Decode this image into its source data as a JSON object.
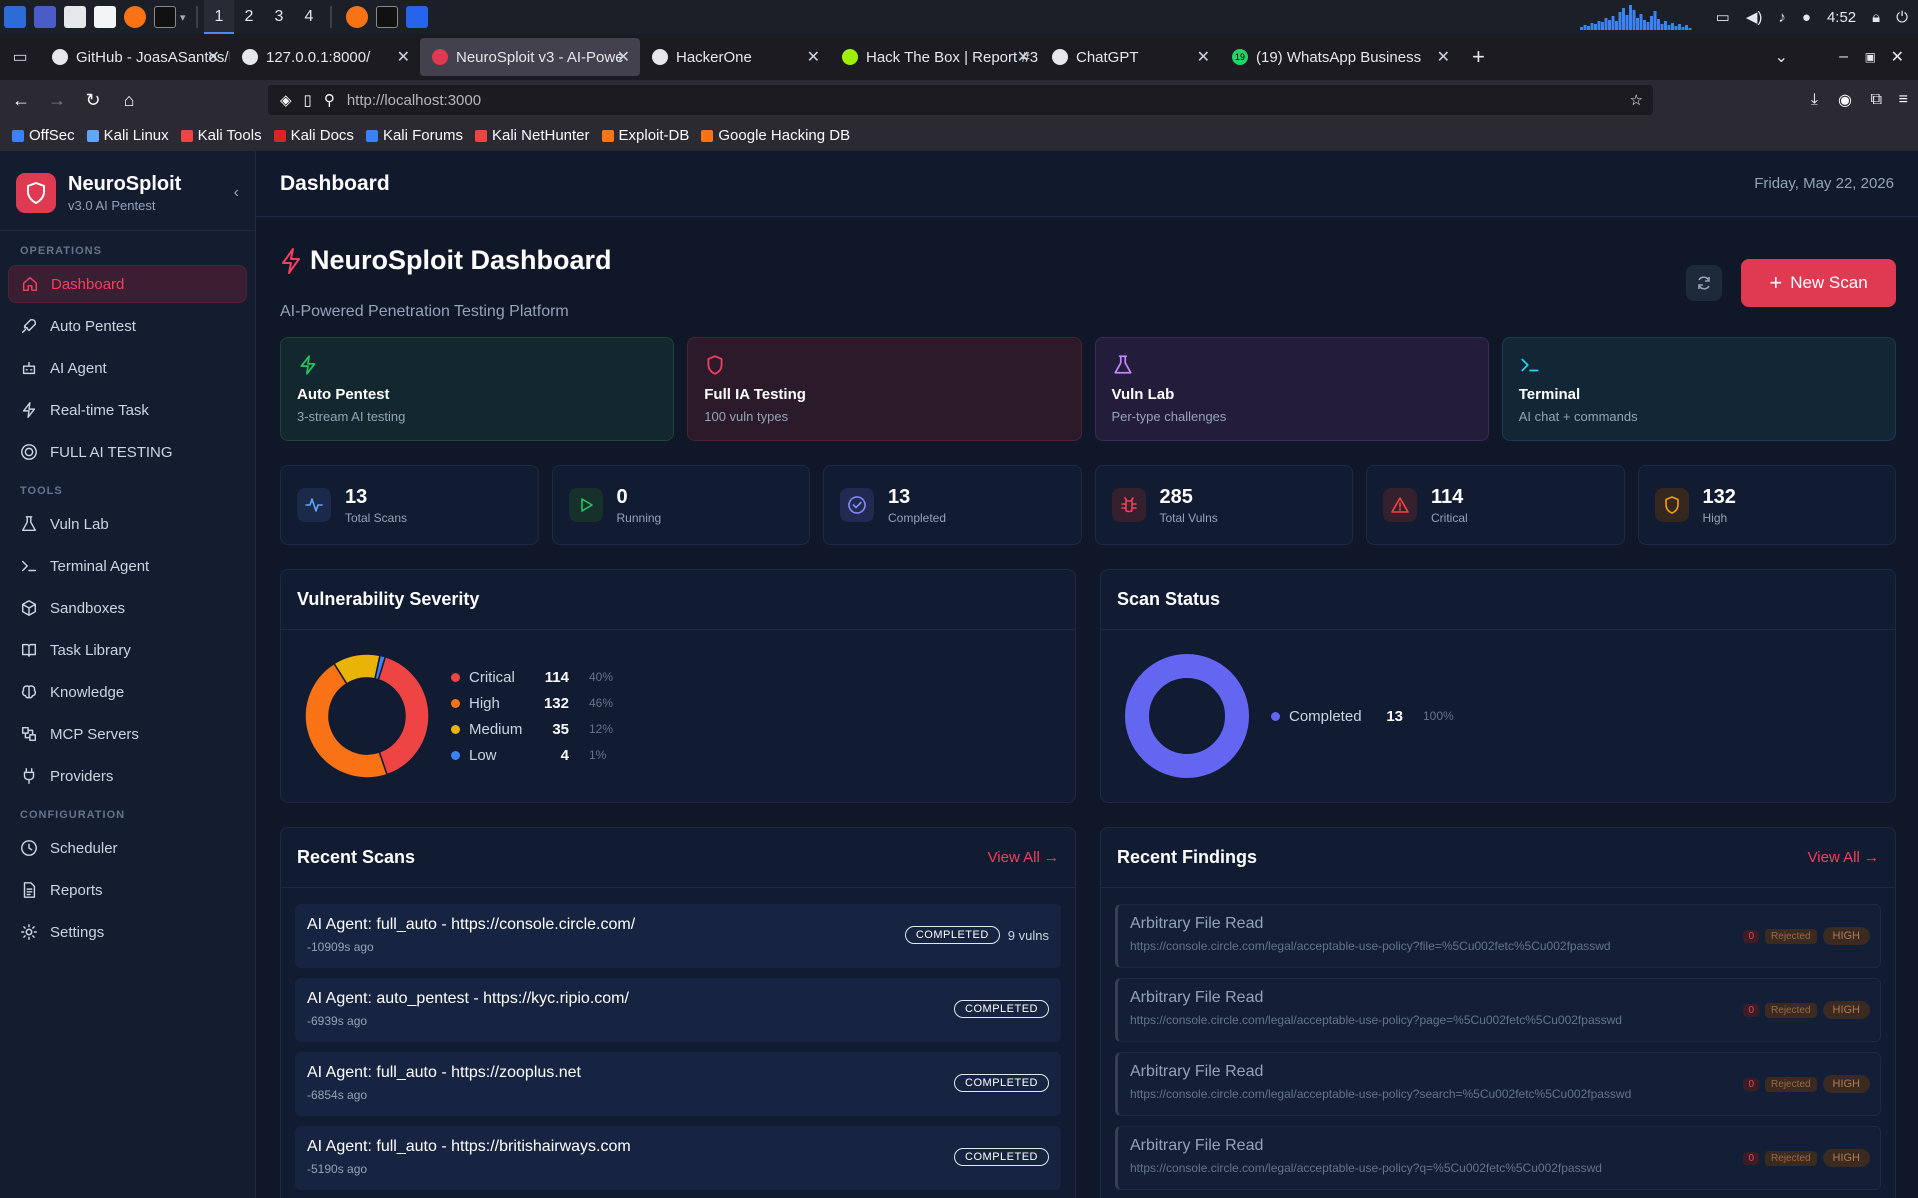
{
  "taskbar": {
    "workspaces": [
      "1",
      "2",
      "3",
      "4"
    ],
    "clock": "4:52"
  },
  "tabs": [
    {
      "label": "GitHub - JoasASantos/Ne",
      "color": "#e5e7eb"
    },
    {
      "label": "127.0.0.1:8000/",
      "color": "#e5e7eb"
    },
    {
      "label": "NeuroSploit v3 - AI-Powe",
      "color": "#e03a52"
    },
    {
      "label": "HackerOne",
      "color": "#e5e7eb"
    },
    {
      "label": "Hack The Box | Report #3",
      "color": "#9fef00"
    },
    {
      "label": "ChatGPT",
      "color": "#e5e7eb"
    },
    {
      "label": "(19) WhatsApp Business",
      "color": "#25d366"
    }
  ],
  "whatsapp_badge": "19",
  "url": "http://localhost:3000",
  "bookmarks": [
    {
      "label": "OffSec",
      "color": "#3b82f6"
    },
    {
      "label": "Kali Linux",
      "color": "#60a5fa"
    },
    {
      "label": "Kali Tools",
      "color": "#ef4444"
    },
    {
      "label": "Kali Docs",
      "color": "#dc2626"
    },
    {
      "label": "Kali Forums",
      "color": "#3b82f6"
    },
    {
      "label": "Kali NetHunter",
      "color": "#ef4444"
    },
    {
      "label": "Exploit-DB",
      "color": "#f97316"
    },
    {
      "label": "Google Hacking DB",
      "color": "#f97316"
    }
  ],
  "sidebar": {
    "brand": "NeuroSploit",
    "version": "v3.0 AI Pentest",
    "sections": [
      {
        "title": "OPERATIONS",
        "items": [
          {
            "label": "Dashboard",
            "icon": "home-icon",
            "active": true
          },
          {
            "label": "Auto Pentest",
            "icon": "rocket-icon"
          },
          {
            "label": "AI Agent",
            "icon": "bot-icon"
          },
          {
            "label": "Real-time Task",
            "icon": "bolt-icon"
          },
          {
            "label": "FULL AI TESTING",
            "icon": "target-icon"
          }
        ]
      },
      {
        "title": "TOOLS",
        "items": [
          {
            "label": "Vuln Lab",
            "icon": "flask-icon"
          },
          {
            "label": "Terminal Agent",
            "icon": "terminal-icon"
          },
          {
            "label": "Sandboxes",
            "icon": "box-icon"
          },
          {
            "label": "Task Library",
            "icon": "book-icon"
          },
          {
            "label": "Knowledge",
            "icon": "brain-icon"
          },
          {
            "label": "MCP Servers",
            "icon": "server-icon"
          },
          {
            "label": "Providers",
            "icon": "plug-icon"
          }
        ]
      },
      {
        "title": "CONFIGURATION",
        "items": [
          {
            "label": "Scheduler",
            "icon": "clock-icon"
          },
          {
            "label": "Reports",
            "icon": "file-icon"
          },
          {
            "label": "Settings",
            "icon": "gear-icon"
          }
        ]
      }
    ]
  },
  "header": {
    "title": "Dashboard",
    "date": "Friday, May 22, 2026"
  },
  "hero": {
    "title": "NeuroSploit Dashboard",
    "subtitle": "AI-Powered Penetration Testing Platform",
    "new_scan": "New Scan"
  },
  "quick_cards": [
    {
      "title": "Auto Pentest",
      "sub": "3-stream AI testing",
      "icon": "bolt-icon",
      "accent": "#22c55e",
      "bg": "#13272e",
      "border": "#1f4438"
    },
    {
      "title": "Full IA Testing",
      "sub": "100 vuln types",
      "icon": "shield-icon",
      "accent": "#f43f5e",
      "bg": "#2a1a2a",
      "border": "#4a2434"
    },
    {
      "title": "Vuln Lab",
      "sub": "Per-type challenges",
      "icon": "flask-icon",
      "accent": "#c084fc",
      "bg": "#231c3b",
      "border": "#3b2c5a"
    },
    {
      "title": "Terminal",
      "sub": "AI chat + commands",
      "icon": "terminal-icon",
      "accent": "#22d3ee",
      "bg": "#122636",
      "border": "#1d3c50"
    }
  ],
  "stats": [
    {
      "value": "13",
      "label": "Total Scans",
      "icon": "activity-icon",
      "color": "#60a5fa",
      "bg": "#1b2a4a"
    },
    {
      "value": "0",
      "label": "Running",
      "icon": "play-icon",
      "color": "#22c55e",
      "bg": "#16302c"
    },
    {
      "value": "13",
      "label": "Completed",
      "icon": "check-circle-icon",
      "color": "#818cf8",
      "bg": "#222a52"
    },
    {
      "value": "285",
      "label": "Total Vulns",
      "icon": "bug-icon",
      "color": "#f43f5e",
      "bg": "#35202e"
    },
    {
      "value": "114",
      "label": "Critical",
      "icon": "alert-icon",
      "color": "#ef4444",
      "bg": "#35202e"
    },
    {
      "value": "132",
      "label": "High",
      "icon": "shield-icon",
      "color": "#f59e0b",
      "bg": "#33271f"
    }
  ],
  "severity_panel": {
    "title": "Vulnerability Severity"
  },
  "status_panel": {
    "title": "Scan Status"
  },
  "chart_data": [
    {
      "type": "pie",
      "title": "Vulnerability Severity",
      "series": [
        {
          "name": "Critical",
          "value": 114,
          "percent": "40%",
          "color": "#ef4444"
        },
        {
          "name": "High",
          "value": 132,
          "percent": "46%",
          "color": "#f97316"
        },
        {
          "name": "Medium",
          "value": 35,
          "percent": "12%",
          "color": "#eab308"
        },
        {
          "name": "Low",
          "value": 4,
          "percent": "1%",
          "color": "#3b82f6"
        }
      ]
    },
    {
      "type": "pie",
      "title": "Scan Status",
      "series": [
        {
          "name": "Completed",
          "value": 13,
          "percent": "100%",
          "color": "#6366f1"
        }
      ]
    }
  ],
  "recent_scans": {
    "title": "Recent Scans",
    "view_all": "View All",
    "rows": [
      {
        "title": "AI Agent: full_auto - https://console.circle.com/",
        "ago": "-10909s ago",
        "status": "COMPLETED",
        "vulns": "9 vulns"
      },
      {
        "title": "AI Agent: auto_pentest - https://kyc.ripio.com/",
        "ago": "-6939s ago",
        "status": "COMPLETED",
        "vulns": ""
      },
      {
        "title": "AI Agent: full_auto - https://zooplus.net",
        "ago": "-6854s ago",
        "status": "COMPLETED",
        "vulns": ""
      },
      {
        "title": "AI Agent: full_auto - https://britishairways.com",
        "ago": "-5190s ago",
        "status": "COMPLETED",
        "vulns": ""
      }
    ]
  },
  "recent_findings": {
    "title": "Recent Findings",
    "view_all": "View All",
    "rows": [
      {
        "title": "Arbitrary File Read",
        "url": "https://console.circle.com/legal/acceptable-use-policy?file=%5Cu002fetc%5Cu002fpasswd",
        "count": "0",
        "state": "Rejected",
        "severity": "HIGH"
      },
      {
        "title": "Arbitrary File Read",
        "url": "https://console.circle.com/legal/acceptable-use-policy?page=%5Cu002fetc%5Cu002fpasswd",
        "count": "0",
        "state": "Rejected",
        "severity": "HIGH"
      },
      {
        "title": "Arbitrary File Read",
        "url": "https://console.circle.com/legal/acceptable-use-policy?search=%5Cu002fetc%5Cu002fpasswd",
        "count": "0",
        "state": "Rejected",
        "severity": "HIGH"
      },
      {
        "title": "Arbitrary File Read",
        "url": "https://console.circle.com/legal/acceptable-use-policy?q=%5Cu002fetc%5Cu002fpasswd",
        "count": "0",
        "state": "Rejected",
        "severity": "HIGH"
      }
    ]
  }
}
